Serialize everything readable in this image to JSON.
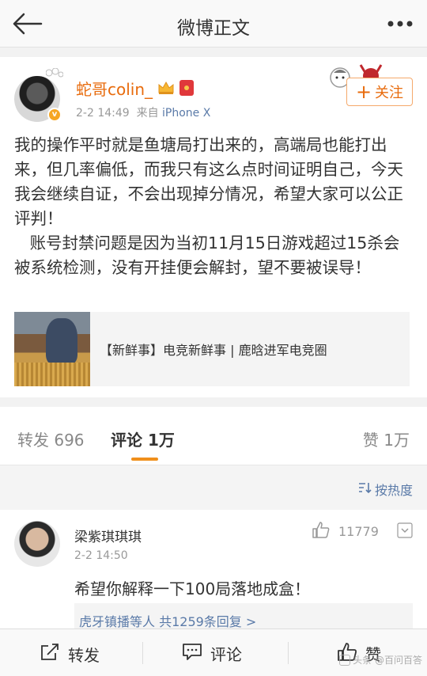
{
  "nav": {
    "title": "微博正文"
  },
  "post": {
    "username": "蛇哥colin_",
    "time": "2-2 14:49",
    "source_prefix": "来自",
    "source": "iPhone X",
    "follow_label": "关注",
    "text": "我的操作平时就是鱼塘局打出来的，高端局也能打出来，但几率偏低，而我只有这么点时间证明自己，今天我会继续自证，不会出现掉分情况，希望大家可以公正评判！\n   账号封禁问题是因为当初11月15日游戏超过15杀会被系统检测，没有开挂便会解封，望不要被误导！",
    "card_text": "【新鲜事】电竞新鲜事 | 鹿晗进军电竞圈"
  },
  "tabs": {
    "repost": "转发 696",
    "comment": "评论 1万",
    "like": "赞 1万"
  },
  "sort": {
    "label": "按热度"
  },
  "comment": {
    "name": "梁紫琪琪琪",
    "time": "2-2 14:50",
    "likes": "11779",
    "text": "希望你解释一下100局落地成盒！",
    "sub": "虎牙镇播等人 共1259条回复 >"
  },
  "bottom": {
    "repost": "转发",
    "comment": "评论",
    "like": "赞",
    "watermark": "头条 @百问百答"
  },
  "colors": {
    "accent": "#f08f1b",
    "username": "#e86b0c",
    "link": "#5a7aa8"
  }
}
